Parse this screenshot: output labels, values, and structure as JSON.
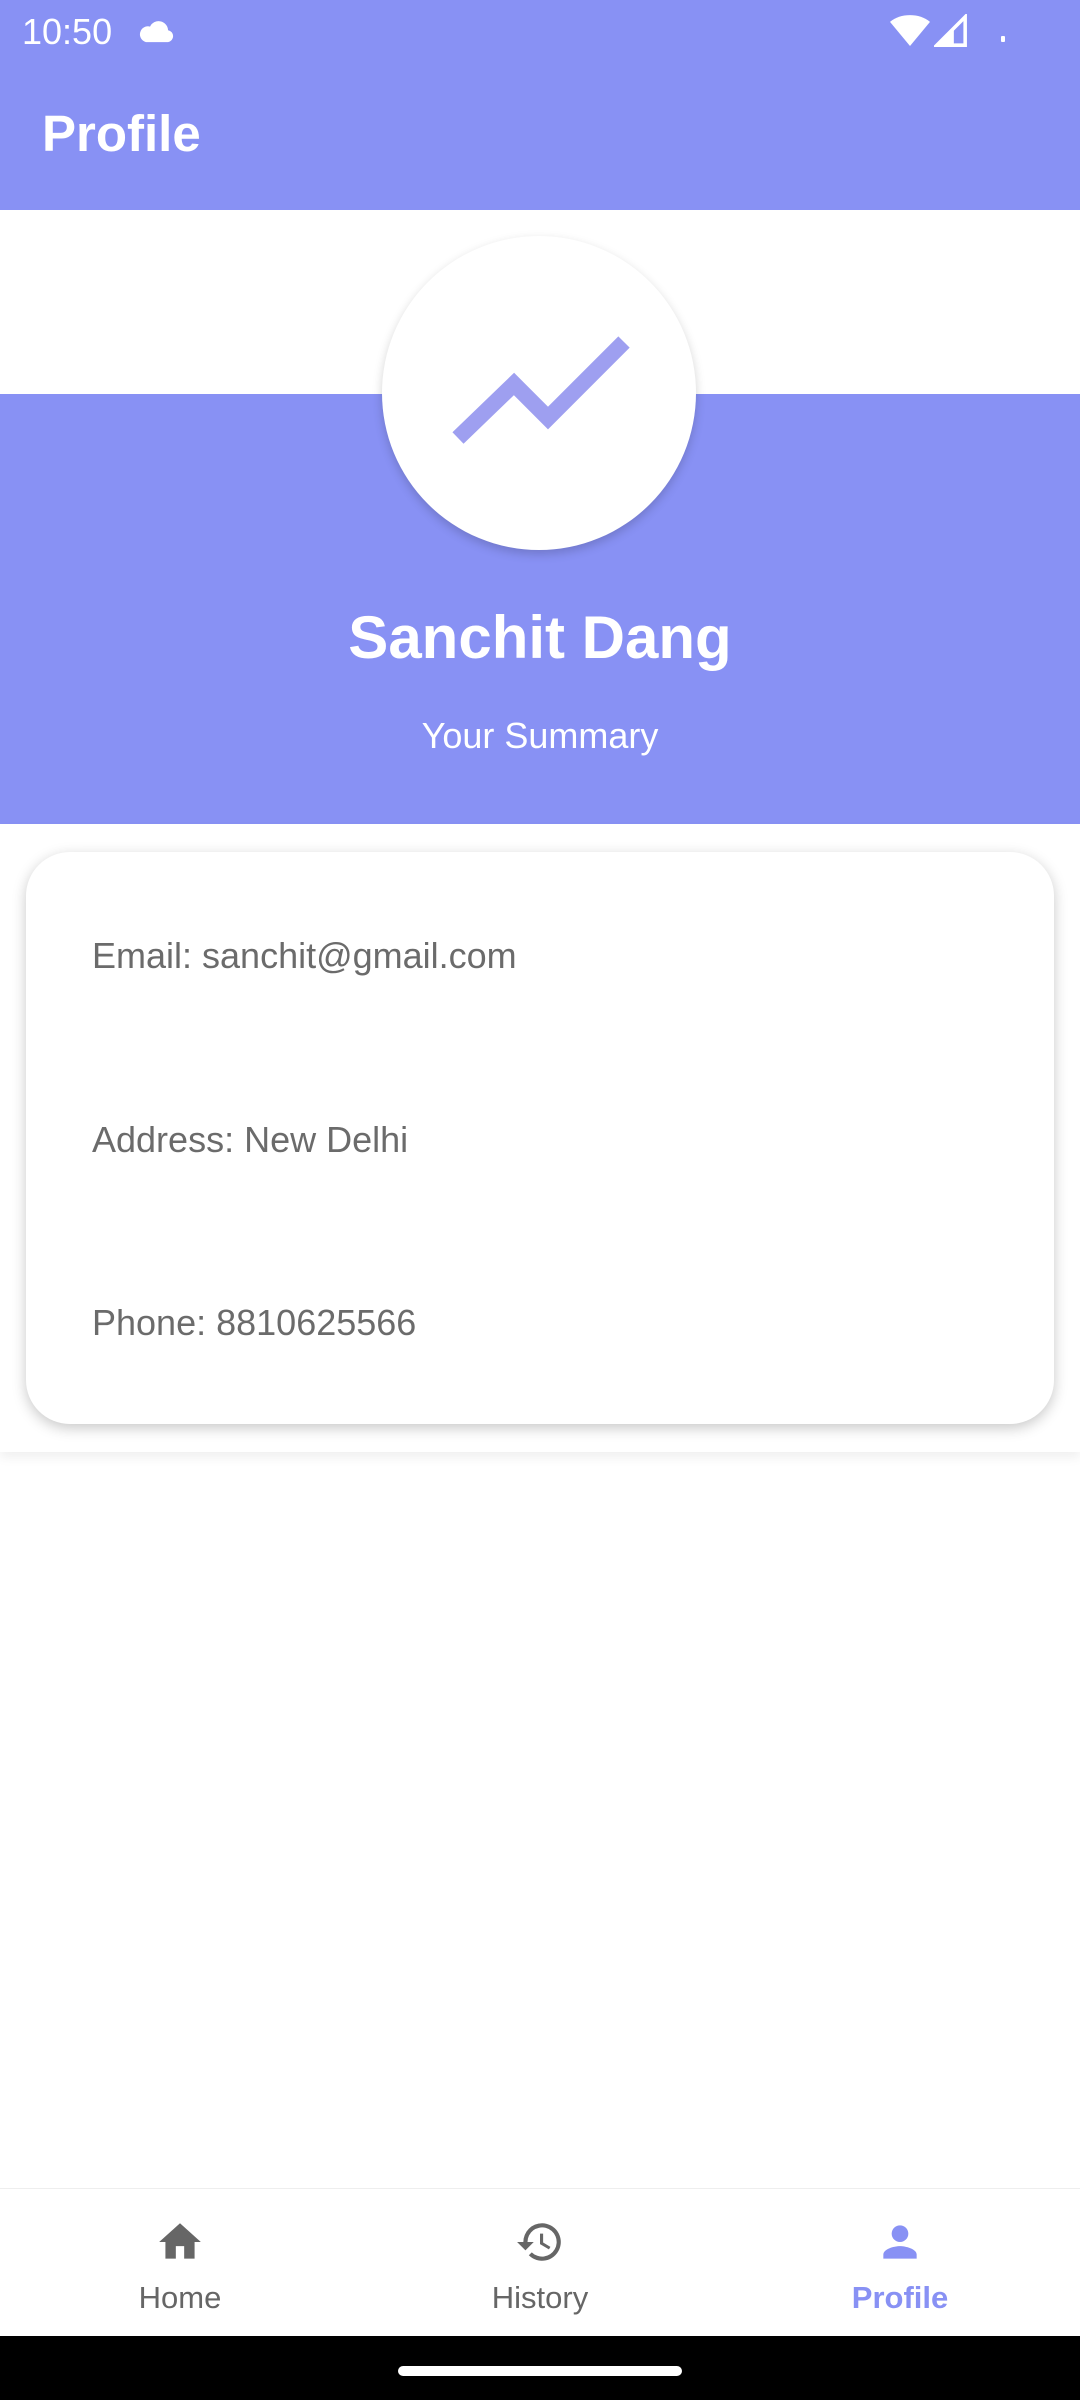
{
  "status_bar": {
    "time": "10:50",
    "icons": [
      "cloud-icon",
      "wifi-icon",
      "cell-signal-icon"
    ]
  },
  "app_bar": {
    "title": "Profile"
  },
  "profile": {
    "avatar_icon": "trending-up-icon",
    "name": "Sanchit Dang",
    "summary": "Your Summary"
  },
  "details": {
    "email": "Email: sanchit@gmail.com",
    "address": "Address: New Delhi",
    "phone": "Phone: 8810625566"
  },
  "bottom_nav": {
    "items": [
      {
        "label": "Home",
        "icon": "home-icon",
        "active": false
      },
      {
        "label": "History",
        "icon": "history-icon",
        "active": false
      },
      {
        "label": "Profile",
        "icon": "person-icon",
        "active": true
      }
    ]
  },
  "colors": {
    "accent": "#8891f4",
    "text_secondary": "#6b6b6b",
    "nav_inactive": "#666666",
    "background": "#ffffff"
  }
}
